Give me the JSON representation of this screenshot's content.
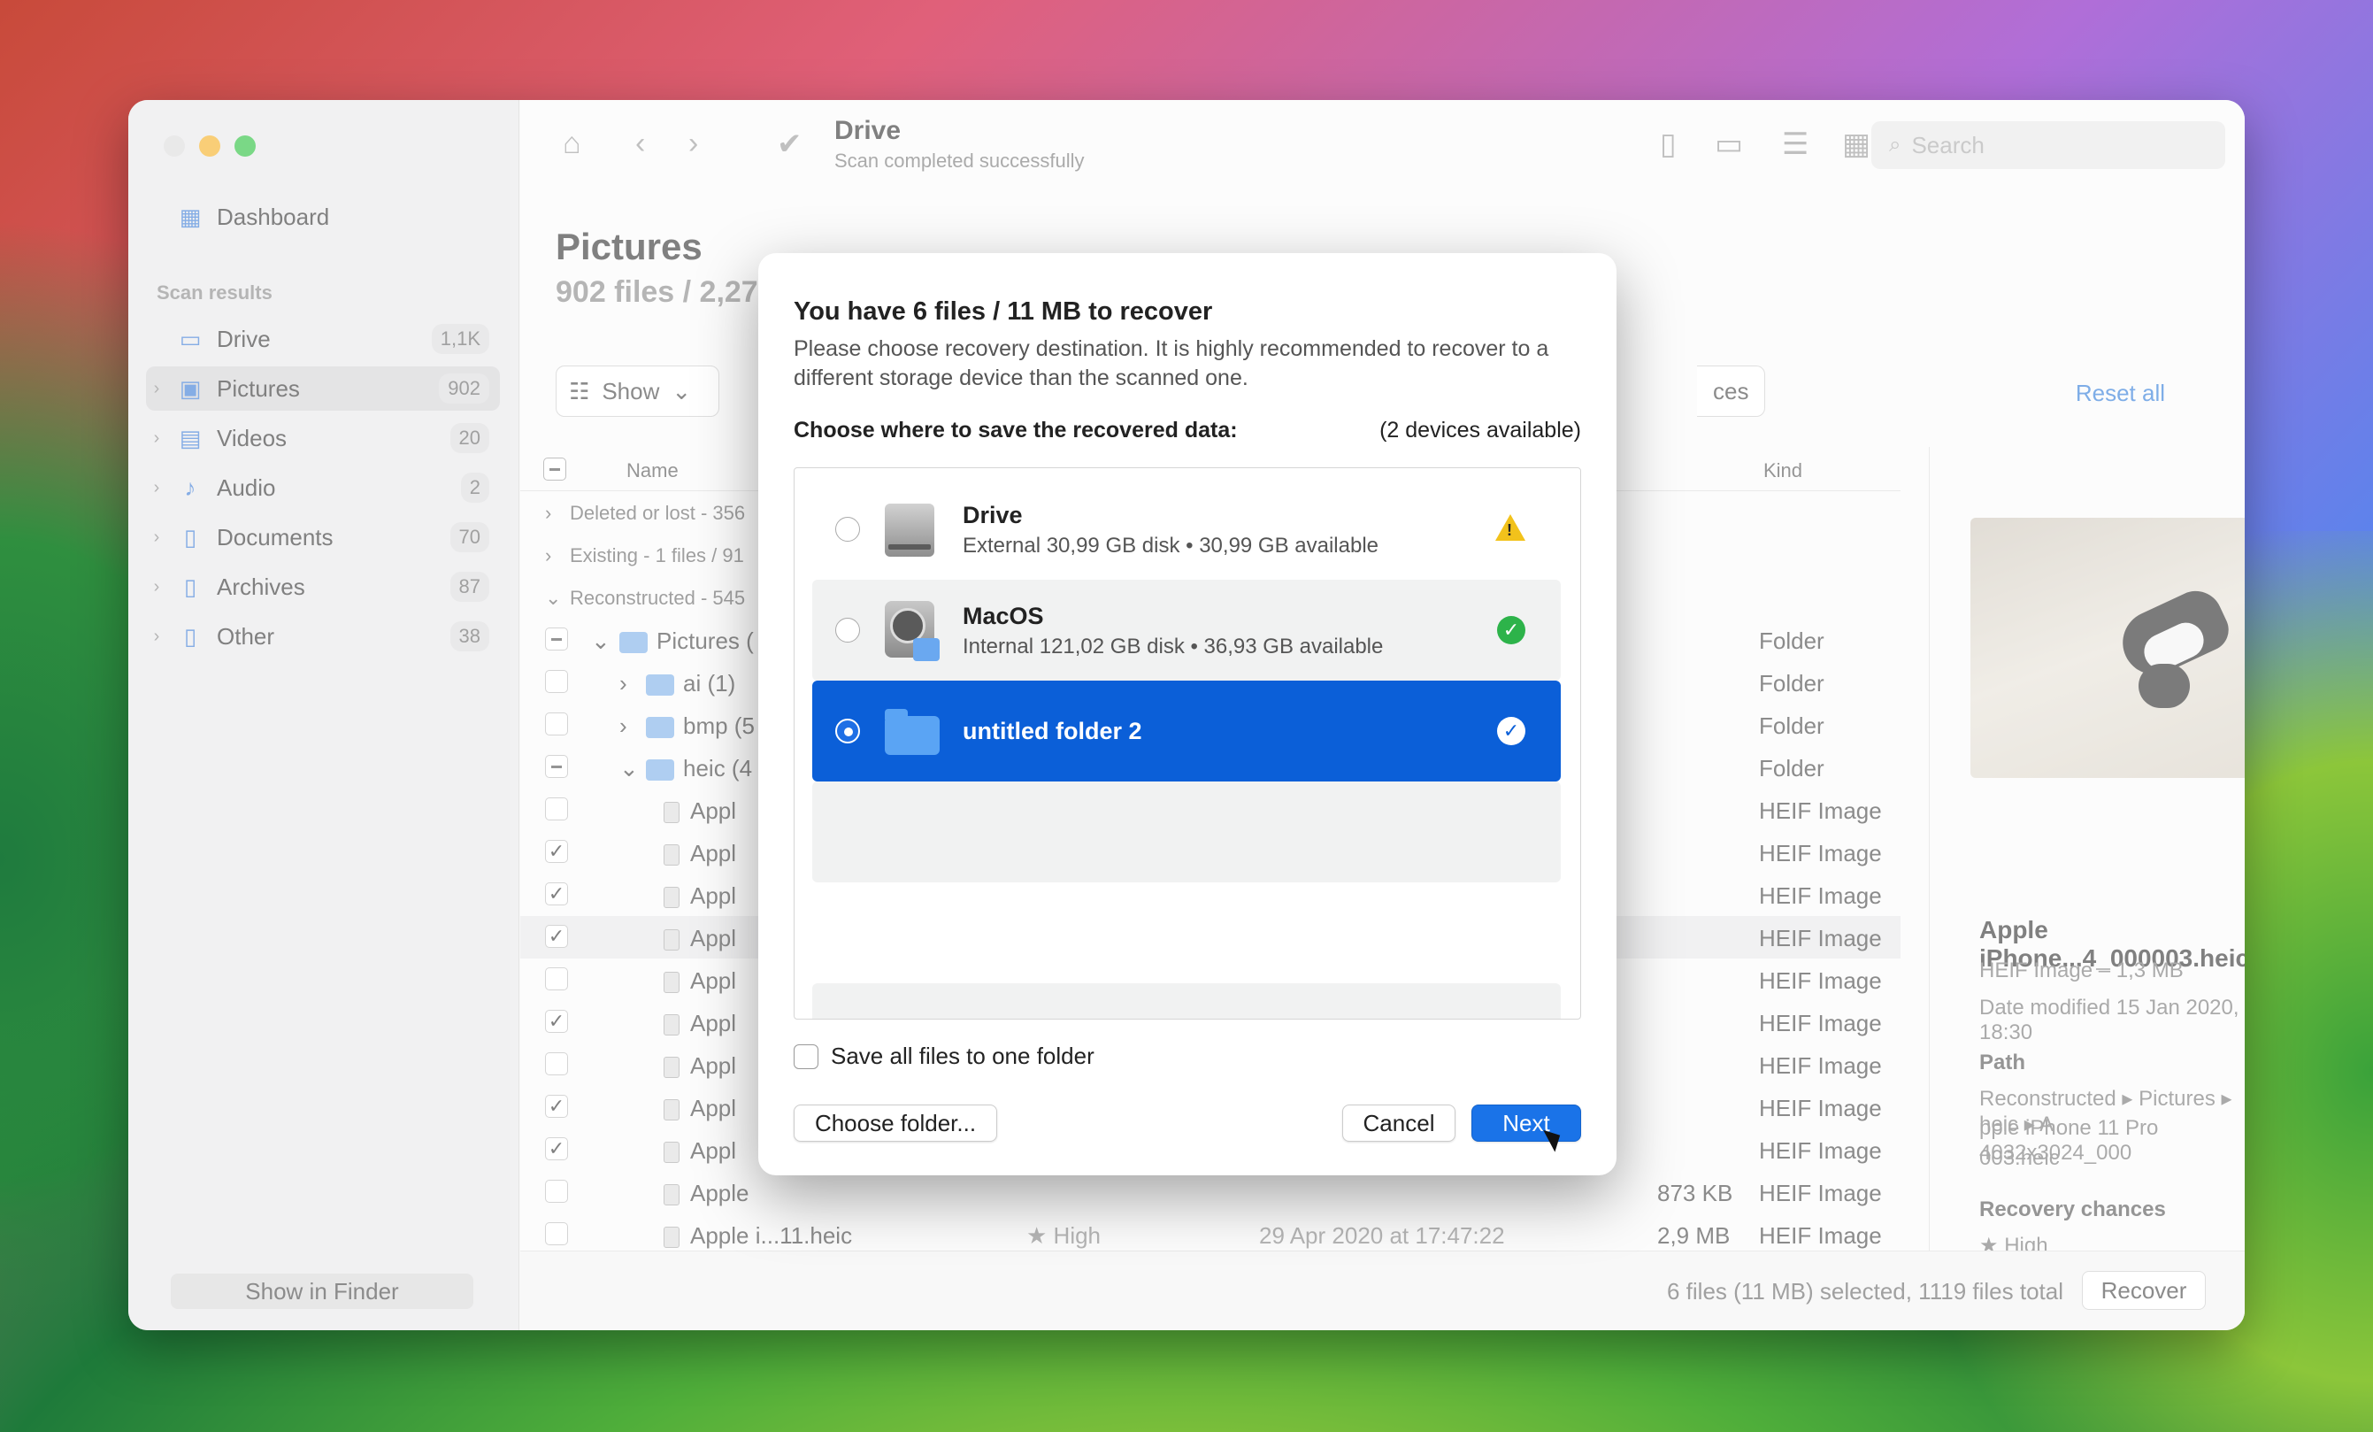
{
  "sidebar": {
    "dashboard": "Dashboard",
    "scan_results_heading": "Scan results",
    "items": [
      {
        "label": "Drive",
        "count": "1,1K"
      },
      {
        "label": "Pictures",
        "count": "902"
      },
      {
        "label": "Videos",
        "count": "20"
      },
      {
        "label": "Audio",
        "count": "2"
      },
      {
        "label": "Documents",
        "count": "70"
      },
      {
        "label": "Archives",
        "count": "87"
      },
      {
        "label": "Other",
        "count": "38"
      }
    ],
    "show_in_finder": "Show in Finder"
  },
  "toolbar": {
    "title": "Drive",
    "subtitle": "Scan completed successfully",
    "search_placeholder": "Search"
  },
  "main": {
    "page_title": "Pictures",
    "page_subtitle": "902 files / 2,27",
    "show_label": "Show",
    "ces_fragment": "ces",
    "reset_all": "Reset all",
    "col_name": "Name",
    "col_kind": "Kind"
  },
  "table": {
    "groups": [
      {
        "label": "Deleted or lost - 356"
      },
      {
        "label": "Existing - 1 files / 91"
      },
      {
        "label": "Reconstructed - 545"
      }
    ],
    "rows": [
      {
        "name": "Pictures (",
        "kind": "Folder"
      },
      {
        "name": "ai (1)",
        "kind": "Folder"
      },
      {
        "name": "bmp (5",
        "kind": "Folder"
      },
      {
        "name": "heic (4",
        "kind": "Folder"
      },
      {
        "name": "Appl",
        "kind": "HEIF Image"
      },
      {
        "name": "Appl",
        "kind": "HEIF Image"
      },
      {
        "name": "Appl",
        "kind": "HEIF Image"
      },
      {
        "name": "Appl",
        "kind": "HEIF Image"
      },
      {
        "name": "Appl",
        "kind": "HEIF Image"
      },
      {
        "name": "Appl",
        "kind": "HEIF Image"
      },
      {
        "name": "Appl",
        "kind": "HEIF Image"
      },
      {
        "name": "Appl",
        "kind": "HEIF Image"
      },
      {
        "name": "Appl",
        "kind": "HEIF Image"
      },
      {
        "name": "Apple",
        "size": "873 KB",
        "kind": "HEIF Image"
      },
      {
        "name": "Apple i...11.heic",
        "chance": "High",
        "date": "29 Apr 2020 at 17:47:22",
        "size": "2,9 MB",
        "kind": "HEIF Image"
      }
    ]
  },
  "preview": {
    "file_name": "Apple iPhone...4_000003.heic",
    "kind_size": "HEIF Image – 1,3 MB",
    "date_modified": "Date modified  15 Jan 2020, 18:30",
    "path_heading": "Path",
    "path_line1": "Reconstructed ▸ Pictures ▸ heic ▸ A",
    "path_line2": "pple iPhone 11 Pro 4032x3024_000",
    "path_line3": "003.heic",
    "recovery_heading": "Recovery chances",
    "recovery_value": "High"
  },
  "status_bar": {
    "summary": "6 files (11 MB) selected, 1119 files total",
    "recover": "Recover"
  },
  "dialog": {
    "title": "You have 6 files / 11 MB to recover",
    "description": "Please choose recovery destination. It is highly recommended to recover to a different storage device than the scanned one.",
    "choose_label": "Choose where to save the recovered data:",
    "available": "(2 devices available)",
    "devices": [
      {
        "name": "Drive",
        "info": "External 30,99 GB disk • 30,99 GB available",
        "status": "warning-icon"
      },
      {
        "name": "MacOS",
        "info": "Internal 121,02 GB disk • 36,93 GB available",
        "status": "check-icon"
      },
      {
        "name": "untitled folder 2",
        "info": "",
        "status": "selected-check-icon"
      }
    ],
    "save_all_label": "Save all files to one folder",
    "choose_folder": "Choose folder...",
    "cancel": "Cancel",
    "next": "Next"
  },
  "colors": {
    "accent": "#1a73e8",
    "selected_row": "#0b5fd8",
    "warning": "#f2c21b",
    "success": "#2db34a"
  }
}
